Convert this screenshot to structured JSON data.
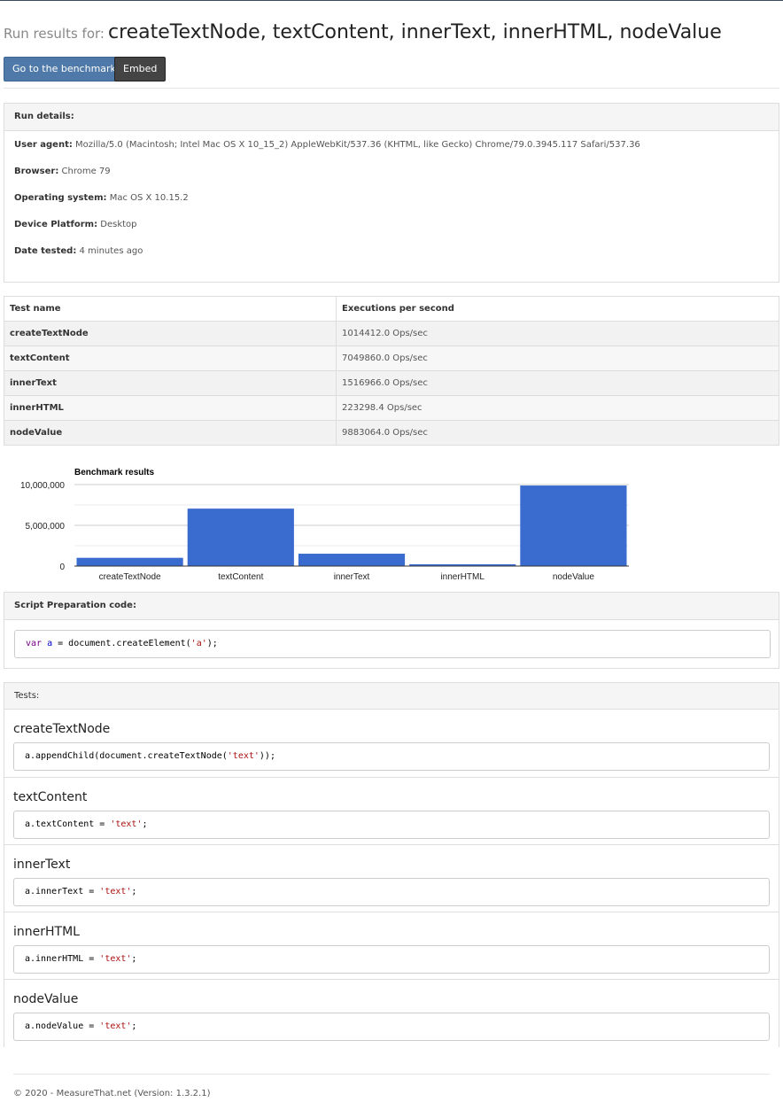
{
  "header": {
    "label": "Run results for:",
    "title": "createTextNode, textContent, innerText, innerHTML, nodeValue",
    "benchmark_button": "Go to the benchmark",
    "embed_button": "Embed"
  },
  "run_details": {
    "heading": "Run details:",
    "user_agent_label": "User agent:",
    "user_agent": "Mozilla/5.0 (Macintosh; Intel Mac OS X 10_15_2) AppleWebKit/537.36 (KHTML, like Gecko) Chrome/79.0.3945.117 Safari/537.36",
    "browser_label": "Browser:",
    "browser": "Chrome 79",
    "os_label": "Operating system:",
    "os": "Mac OS X 10.15.2",
    "platform_label": "Device Platform:",
    "platform": "Desktop",
    "date_label": "Date tested:",
    "date": "4 minutes ago"
  },
  "results_table": {
    "headers": [
      "Test name",
      "Executions per second"
    ],
    "rows": [
      {
        "name": "createTextNode",
        "value": "1014412.0 Ops/sec"
      },
      {
        "name": "textContent",
        "value": "7049860.0 Ops/sec"
      },
      {
        "name": "innerText",
        "value": "1516966.0 Ops/sec"
      },
      {
        "name": "innerHTML",
        "value": "223298.4 Ops/sec"
      },
      {
        "name": "nodeValue",
        "value": "9883064.0 Ops/sec"
      }
    ]
  },
  "chart_data": {
    "type": "bar",
    "title": "Benchmark results",
    "categories": [
      "createTextNode",
      "textContent",
      "innerText",
      "innerHTML",
      "nodeValue"
    ],
    "values": [
      1014412.0,
      7049860.0,
      1516966.0,
      223298.4,
      9883064.0
    ],
    "ylim": [
      0,
      10000000
    ],
    "yticks": [
      0,
      5000000,
      10000000
    ],
    "ytick_labels": [
      "0",
      "5,000,000",
      "10,000,000"
    ],
    "xlabel": "",
    "ylabel": "",
    "grid": true,
    "legend": "none",
    "bar_color": "#3a6bcf"
  },
  "preparation": {
    "heading": "Script Preparation code:",
    "code": {
      "kw": "var",
      "var": "a",
      "rest": " = document.createElement(",
      "str": "'a'",
      "end": ");"
    }
  },
  "tests": {
    "heading": "Tests:",
    "items": [
      {
        "name": "createTextNode",
        "pre": "a.appendChild(document.createTextNode(",
        "str": "'text'",
        "post": "));"
      },
      {
        "name": "textContent",
        "pre": "a.textContent = ",
        "str": "'text'",
        "post": ";"
      },
      {
        "name": "innerText",
        "pre": "a.innerText = ",
        "str": "'text'",
        "post": ";"
      },
      {
        "name": "innerHTML",
        "pre": "a.innerHTML = ",
        "str": "'text'",
        "post": ";"
      },
      {
        "name": "nodeValue",
        "pre": "a.nodeValue = ",
        "str": "'text'",
        "post": ";"
      }
    ]
  },
  "footer": {
    "text": "© 2020 - MeasureThat.net (Version: 1.3.2.1)"
  }
}
